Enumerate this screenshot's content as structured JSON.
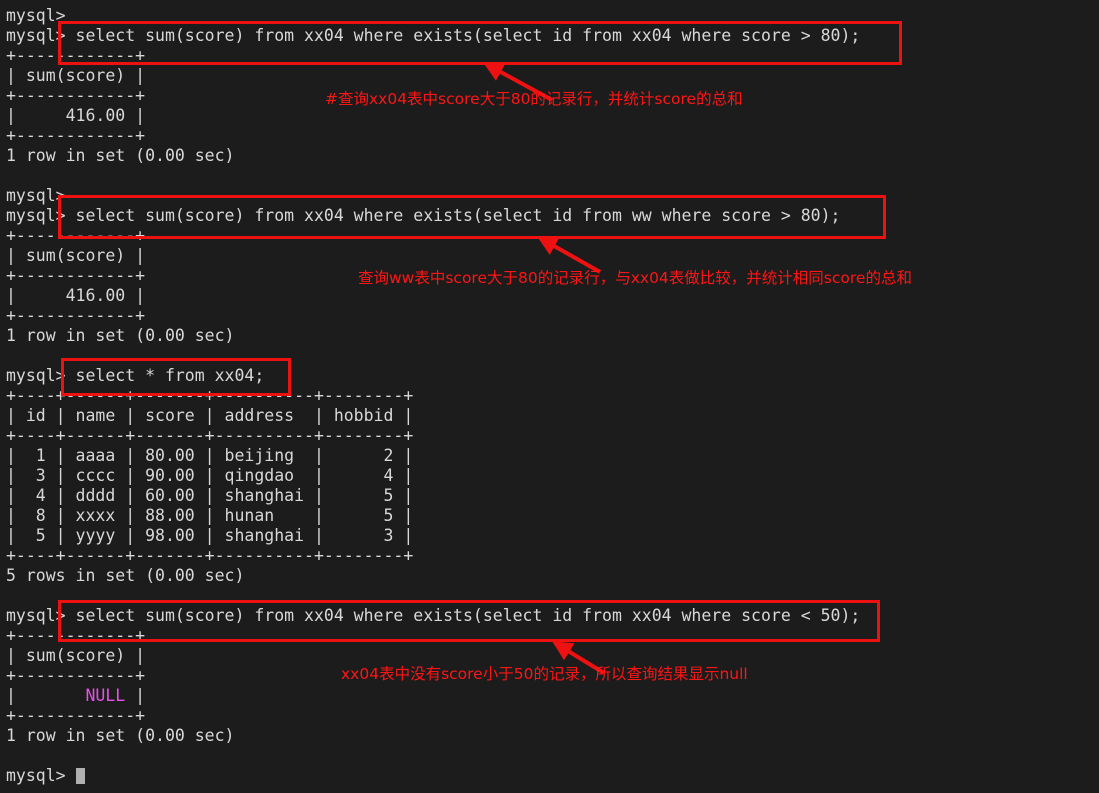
{
  "terminal": {
    "prompt": "mysql>",
    "background_color": "#1c1c1c",
    "text_color": "#d8d8d8",
    "null_color": "#e552e5",
    "annotation_color": "#ff1515",
    "lines": [
      {
        "id": "l01",
        "text": "mysql>"
      },
      {
        "id": "l02",
        "text": "mysql> select sum(score) from xx04 where exists(select id from xx04 where score > 80);"
      },
      {
        "id": "l03",
        "text": "+------------+"
      },
      {
        "id": "l04",
        "text": "| sum(score) |"
      },
      {
        "id": "l05",
        "text": "+------------+"
      },
      {
        "id": "l06",
        "text": "|     416.00 |"
      },
      {
        "id": "l07",
        "text": "+------------+"
      },
      {
        "id": "l08",
        "text": "1 row in set (0.00 sec)"
      },
      {
        "id": "l09",
        "text": ""
      },
      {
        "id": "l10",
        "text": "mysql>"
      },
      {
        "id": "l11",
        "text": "mysql> select sum(score) from xx04 where exists(select id from ww where score > 80);"
      },
      {
        "id": "l12",
        "text": "+------------+"
      },
      {
        "id": "l13",
        "text": "| sum(score) |"
      },
      {
        "id": "l14",
        "text": "+------------+"
      },
      {
        "id": "l15",
        "text": "|     416.00 |"
      },
      {
        "id": "l16",
        "text": "+------------+"
      },
      {
        "id": "l17",
        "text": "1 row in set (0.00 sec)"
      },
      {
        "id": "l18",
        "text": ""
      },
      {
        "id": "l19",
        "text": "mysql> select * from xx04;"
      },
      {
        "id": "l20",
        "text": "+----+------+-------+----------+--------+"
      },
      {
        "id": "l21",
        "text": "| id | name | score | address  | hobbid |"
      },
      {
        "id": "l22",
        "text": "+----+------+-------+----------+--------+"
      },
      {
        "id": "l23",
        "text": "|  1 | aaaa | 80.00 | beijing  |      2 |"
      },
      {
        "id": "l24",
        "text": "|  3 | cccc | 90.00 | qingdao  |      4 |"
      },
      {
        "id": "l25",
        "text": "|  4 | dddd | 60.00 | shanghai |      5 |"
      },
      {
        "id": "l26",
        "text": "|  8 | xxxx | 88.00 | hunan    |      5 |"
      },
      {
        "id": "l27",
        "text": "|  5 | yyyy | 98.00 | shanghai |      3 |"
      },
      {
        "id": "l28",
        "text": "+----+------+-------+----------+--------+"
      },
      {
        "id": "l29",
        "text": "5 rows in set (0.00 sec)"
      },
      {
        "id": "l30",
        "text": ""
      },
      {
        "id": "l31",
        "text": "mysql> select sum(score) from xx04 where exists(select id from xx04 where score < 50);"
      },
      {
        "id": "l32",
        "text": "+------------+"
      },
      {
        "id": "l33",
        "text": "| sum(score) |"
      },
      {
        "id": "l34",
        "text": "+------------+"
      },
      {
        "id": "l35",
        "text": "|       NULL |",
        "null_span": {
          "prefix": "|       ",
          "value": "NULL",
          "suffix": " |"
        }
      },
      {
        "id": "l36",
        "text": "+------------+"
      },
      {
        "id": "l37",
        "text": "1 row in set (0.00 sec)"
      },
      {
        "id": "l38",
        "text": ""
      },
      {
        "id": "l39",
        "text": "mysql> ",
        "cursor": true
      }
    ],
    "result_table": {
      "columns": [
        "id",
        "name",
        "score",
        "address",
        "hobbid"
      ],
      "rows": [
        [
          "1",
          "aaaa",
          "80.00",
          "beijing",
          "2"
        ],
        [
          "3",
          "cccc",
          "90.00",
          "qingdao",
          "4"
        ],
        [
          "4",
          "dddd",
          "60.00",
          "shanghai",
          "5"
        ],
        [
          "8",
          "xxxx",
          "88.00",
          "hunan",
          "5"
        ],
        [
          "5",
          "yyyy",
          "98.00",
          "shanghai",
          "3"
        ]
      ],
      "row_count_text": "5 rows in set (0.00 sec)"
    },
    "queries": [
      "select sum(score) from xx04 where exists(select id from xx04 where score > 80);",
      "select sum(score) from xx04 where exists(select id from ww where score > 80);",
      "select * from xx04;",
      "select sum(score) from xx04 where exists(select id from xx04 where score < 50);"
    ],
    "results": [
      "416.00",
      "416.00",
      "NULL"
    ]
  },
  "annotations": {
    "note1": "#查询xx04表中score大于80的记录行，并统计score的总和",
    "note2": "查询ww表中score大于80的记录行，与xx04表做比较，并统计相同score的总和",
    "note3": "xx04表中没有score小于50的记录，所以查询结果显示null"
  }
}
